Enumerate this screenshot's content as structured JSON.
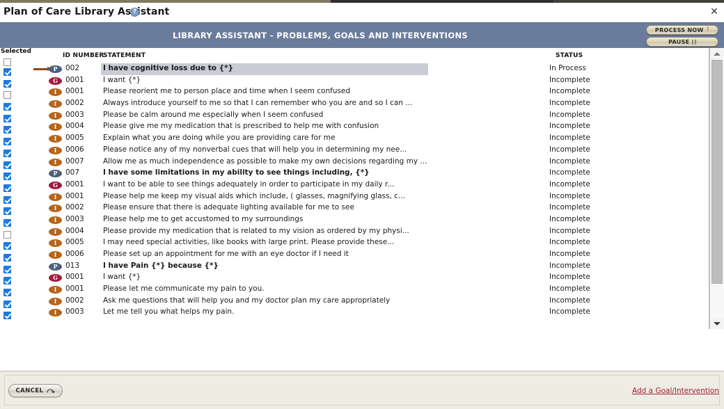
{
  "window": {
    "title": "Plan of Care Library Assistant",
    "help_icon": "help-circle-icon",
    "close_icon": "close-icon"
  },
  "banner": {
    "title": "LIBRARY ASSISTANT - PROBLEMS, GOALS AND INTERVENTIONS",
    "bg_color": "#6a7c9b",
    "buttons": [
      {
        "label": "PROCESS NOW",
        "icon": "exclamation-icon"
      },
      {
        "label": "PAUSE",
        "icon": "pause-icon"
      }
    ]
  },
  "table": {
    "columns": {
      "selected": "Selected",
      "id_number": "ID NUMBER",
      "statement": "STATEMENT",
      "status": "STATUS"
    },
    "select_all_checked": false,
    "rows": [
      {
        "checked": true,
        "type": "P",
        "id": "002",
        "statement": "I have cognitive loss due to {*}",
        "status": "In Process",
        "bold": true,
        "selected": true
      },
      {
        "checked": true,
        "type": "G",
        "id": "0001",
        "statement": "I want {*}",
        "status": "Incomplete",
        "bold": false,
        "selected": false
      },
      {
        "checked": false,
        "type": "I",
        "id": "0001",
        "statement": "Please reorient me to person place and time when I seem confused",
        "status": "Incomplete",
        "bold": false,
        "selected": false
      },
      {
        "checked": true,
        "type": "I",
        "id": "0002",
        "statement": "Always introduce yourself to me so that I can remember who you are and so I can ...",
        "status": "Incomplete",
        "bold": false,
        "selected": false
      },
      {
        "checked": true,
        "type": "I",
        "id": "0003",
        "statement": "Please be calm around me especially when I seem confused",
        "status": "Incomplete",
        "bold": false,
        "selected": false
      },
      {
        "checked": true,
        "type": "I",
        "id": "0004",
        "statement": "Please give me my medication that is prescribed to help me with confusion",
        "status": "Incomplete",
        "bold": false,
        "selected": false
      },
      {
        "checked": true,
        "type": "I",
        "id": "0005",
        "statement": "Explain what you are doing while you are providing care for me",
        "status": "Incomplete",
        "bold": false,
        "selected": false
      },
      {
        "checked": true,
        "type": "I",
        "id": "0006",
        "statement": "Please notice any of my nonverbal cues that will help you in determining my nee...",
        "status": "Incomplete",
        "bold": false,
        "selected": false
      },
      {
        "checked": true,
        "type": "I",
        "id": "0007",
        "statement": "Allow me as much independence as possible to make my own decisions regarding my ...",
        "status": "Incomplete",
        "bold": false,
        "selected": false
      },
      {
        "checked": true,
        "type": "P",
        "id": "007",
        "statement": "I have some limitations in my ability to see things including, {*}",
        "status": "Incomplete",
        "bold": true,
        "selected": false
      },
      {
        "checked": true,
        "type": "G",
        "id": "0001",
        "statement": "I want to be able to see things adequately in order to participate in my daily r...",
        "status": "Incomplete",
        "bold": false,
        "selected": false
      },
      {
        "checked": true,
        "type": "I",
        "id": "0001",
        "statement": "Please help me keep my visual aids which include, ( glasses, magnifying glass, c...",
        "status": "Incomplete",
        "bold": false,
        "selected": false
      },
      {
        "checked": true,
        "type": "I",
        "id": "0002",
        "statement": "Please ensure that there is adequate lighting available for me to see",
        "status": "Incomplete",
        "bold": false,
        "selected": false
      },
      {
        "checked": true,
        "type": "I",
        "id": "0003",
        "statement": "Please help me to get accustomed to my surroundings",
        "status": "Incomplete",
        "bold": false,
        "selected": false
      },
      {
        "checked": false,
        "type": "I",
        "id": "0004",
        "statement": "Please provide my medication that is related to my vision as ordered by my physi...",
        "status": "Incomplete",
        "bold": false,
        "selected": false
      },
      {
        "checked": true,
        "type": "I",
        "id": "0005",
        "statement": "I may need special activities, like books with large print. Please provide these...",
        "status": "Incomplete",
        "bold": false,
        "selected": false
      },
      {
        "checked": true,
        "type": "I",
        "id": "0006",
        "statement": "Please set up an appointment for me with an eye doctor if I need it",
        "status": "Incomplete",
        "bold": false,
        "selected": false
      },
      {
        "checked": true,
        "type": "P",
        "id": "013",
        "statement": "I have Pain {*} because {*}",
        "status": "Incomplete",
        "bold": true,
        "selected": false
      },
      {
        "checked": true,
        "type": "G",
        "id": "0001",
        "statement": "I want {*}",
        "status": "Incomplete",
        "bold": false,
        "selected": false
      },
      {
        "checked": true,
        "type": "I",
        "id": "0001",
        "statement": "Please let me communicate my pain to you.",
        "status": "Incomplete",
        "bold": false,
        "selected": false
      },
      {
        "checked": true,
        "type": "I",
        "id": "0002",
        "statement": "Ask me questions that will help you and my doctor plan my care appropriately",
        "status": "Incomplete",
        "bold": false,
        "selected": false
      },
      {
        "checked": true,
        "type": "I",
        "id": "0003",
        "statement": "Let me tell you what helps my pain.",
        "status": "Incomplete",
        "bold": false,
        "selected": false
      }
    ],
    "badge_colors": {
      "P": "#4c6080",
      "G": "#a41b3c",
      "I": "#b5651d"
    }
  },
  "scrollbar": {
    "up_icon": "scroll-up-arrow-icon",
    "down_icon": "scroll-down-arrow-icon"
  },
  "footer": {
    "cancel_label": "CANCEL",
    "cancel_icon": "undo-arrow-icon",
    "add_link": "Add a Goal/Intervention",
    "link_color": "#9d2235"
  }
}
